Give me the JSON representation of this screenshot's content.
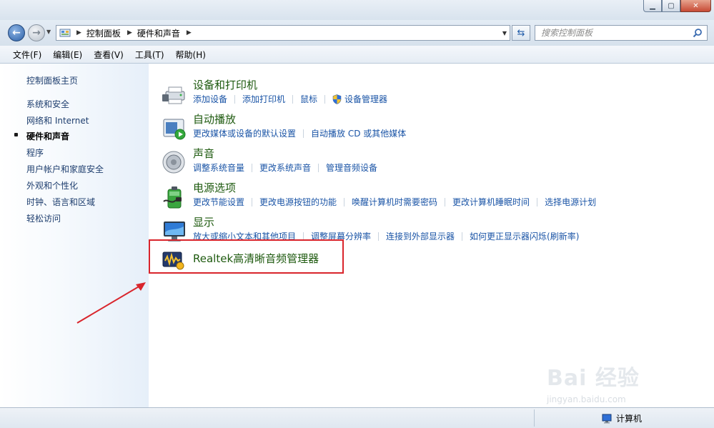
{
  "breadcrumb": {
    "items": [
      "控制面板",
      "硬件和声音"
    ]
  },
  "search": {
    "placeholder": "搜索控制面板"
  },
  "menu": {
    "items": [
      "文件(F)",
      "编辑(E)",
      "查看(V)",
      "工具(T)",
      "帮助(H)"
    ]
  },
  "sidebar": {
    "items": [
      {
        "label": "控制面板主页",
        "current": false
      },
      {
        "label": "系统和安全",
        "current": false
      },
      {
        "label": "网络和 Internet",
        "current": false
      },
      {
        "label": "硬件和声音",
        "current": true
      },
      {
        "label": "程序",
        "current": false
      },
      {
        "label": "用户帐户和家庭安全",
        "current": false
      },
      {
        "label": "外观和个性化",
        "current": false
      },
      {
        "label": "时钟、语言和区域",
        "current": false
      },
      {
        "label": "轻松访问",
        "current": false
      }
    ]
  },
  "categories": [
    {
      "title": "设备和打印机",
      "icon": "printer-icon",
      "links": [
        "添加设备",
        "添加打印机",
        "鼠标",
        "设备管理器"
      ]
    },
    {
      "title": "自动播放",
      "icon": "autoplay-icon",
      "links": [
        "更改媒体或设备的默认设置",
        "自动播放 CD 或其他媒体"
      ]
    },
    {
      "title": "声音",
      "icon": "speaker-icon",
      "links": [
        "调整系统音量",
        "更改系统声音",
        "管理音频设备"
      ]
    },
    {
      "title": "电源选项",
      "icon": "battery-icon",
      "links": [
        "更改节能设置",
        "更改电源按钮的功能",
        "唤醒计算机时需要密码",
        "更改计算机睡眠时间",
        "选择电源计划"
      ]
    },
    {
      "title": "显示",
      "icon": "monitor-icon",
      "links": [
        "放大或缩小文本和其他项目",
        "调整屏幕分辨率",
        "连接到外部显示器",
        "如何更正显示器闪烁(刷新率)"
      ]
    }
  ],
  "realtek": {
    "title": "Realtek高清晰音频管理器",
    "icon": "realtek-audio-icon"
  },
  "statusbar": {
    "location": "计算机"
  },
  "watermark": {
    "text": "Bai 经验",
    "sub": "jingyan.baidu.com"
  },
  "colors": {
    "link": "#1a54a6",
    "category_title": "#1e5a0f",
    "highlight": "#d9252c",
    "annotation_arrow": "#d9252c"
  }
}
